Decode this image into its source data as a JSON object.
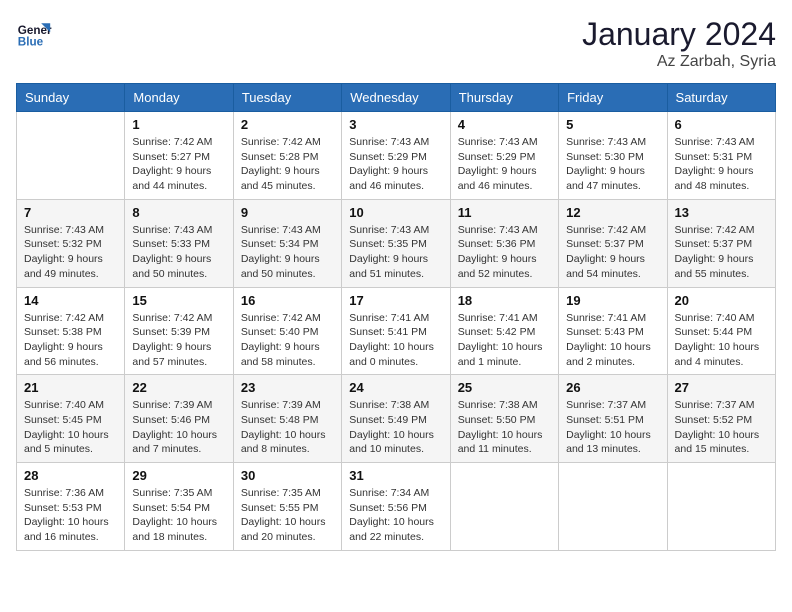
{
  "logo": {
    "line1": "General",
    "line2": "Blue"
  },
  "title": "January 2024",
  "location": "Az Zarbah, Syria",
  "days_header": [
    "Sunday",
    "Monday",
    "Tuesday",
    "Wednesday",
    "Thursday",
    "Friday",
    "Saturday"
  ],
  "weeks": [
    [
      {
        "day": "",
        "info": ""
      },
      {
        "day": "1",
        "info": "Sunrise: 7:42 AM\nSunset: 5:27 PM\nDaylight: 9 hours\nand 44 minutes."
      },
      {
        "day": "2",
        "info": "Sunrise: 7:42 AM\nSunset: 5:28 PM\nDaylight: 9 hours\nand 45 minutes."
      },
      {
        "day": "3",
        "info": "Sunrise: 7:43 AM\nSunset: 5:29 PM\nDaylight: 9 hours\nand 46 minutes."
      },
      {
        "day": "4",
        "info": "Sunrise: 7:43 AM\nSunset: 5:29 PM\nDaylight: 9 hours\nand 46 minutes."
      },
      {
        "day": "5",
        "info": "Sunrise: 7:43 AM\nSunset: 5:30 PM\nDaylight: 9 hours\nand 47 minutes."
      },
      {
        "day": "6",
        "info": "Sunrise: 7:43 AM\nSunset: 5:31 PM\nDaylight: 9 hours\nand 48 minutes."
      }
    ],
    [
      {
        "day": "7",
        "info": "Sunrise: 7:43 AM\nSunset: 5:32 PM\nDaylight: 9 hours\nand 49 minutes."
      },
      {
        "day": "8",
        "info": "Sunrise: 7:43 AM\nSunset: 5:33 PM\nDaylight: 9 hours\nand 50 minutes."
      },
      {
        "day": "9",
        "info": "Sunrise: 7:43 AM\nSunset: 5:34 PM\nDaylight: 9 hours\nand 50 minutes."
      },
      {
        "day": "10",
        "info": "Sunrise: 7:43 AM\nSunset: 5:35 PM\nDaylight: 9 hours\nand 51 minutes."
      },
      {
        "day": "11",
        "info": "Sunrise: 7:43 AM\nSunset: 5:36 PM\nDaylight: 9 hours\nand 52 minutes."
      },
      {
        "day": "12",
        "info": "Sunrise: 7:42 AM\nSunset: 5:37 PM\nDaylight: 9 hours\nand 54 minutes."
      },
      {
        "day": "13",
        "info": "Sunrise: 7:42 AM\nSunset: 5:37 PM\nDaylight: 9 hours\nand 55 minutes."
      }
    ],
    [
      {
        "day": "14",
        "info": "Sunrise: 7:42 AM\nSunset: 5:38 PM\nDaylight: 9 hours\nand 56 minutes."
      },
      {
        "day": "15",
        "info": "Sunrise: 7:42 AM\nSunset: 5:39 PM\nDaylight: 9 hours\nand 57 minutes."
      },
      {
        "day": "16",
        "info": "Sunrise: 7:42 AM\nSunset: 5:40 PM\nDaylight: 9 hours\nand 58 minutes."
      },
      {
        "day": "17",
        "info": "Sunrise: 7:41 AM\nSunset: 5:41 PM\nDaylight: 10 hours\nand 0 minutes."
      },
      {
        "day": "18",
        "info": "Sunrise: 7:41 AM\nSunset: 5:42 PM\nDaylight: 10 hours\nand 1 minute."
      },
      {
        "day": "19",
        "info": "Sunrise: 7:41 AM\nSunset: 5:43 PM\nDaylight: 10 hours\nand 2 minutes."
      },
      {
        "day": "20",
        "info": "Sunrise: 7:40 AM\nSunset: 5:44 PM\nDaylight: 10 hours\nand 4 minutes."
      }
    ],
    [
      {
        "day": "21",
        "info": "Sunrise: 7:40 AM\nSunset: 5:45 PM\nDaylight: 10 hours\nand 5 minutes."
      },
      {
        "day": "22",
        "info": "Sunrise: 7:39 AM\nSunset: 5:46 PM\nDaylight: 10 hours\nand 7 minutes."
      },
      {
        "day": "23",
        "info": "Sunrise: 7:39 AM\nSunset: 5:48 PM\nDaylight: 10 hours\nand 8 minutes."
      },
      {
        "day": "24",
        "info": "Sunrise: 7:38 AM\nSunset: 5:49 PM\nDaylight: 10 hours\nand 10 minutes."
      },
      {
        "day": "25",
        "info": "Sunrise: 7:38 AM\nSunset: 5:50 PM\nDaylight: 10 hours\nand 11 minutes."
      },
      {
        "day": "26",
        "info": "Sunrise: 7:37 AM\nSunset: 5:51 PM\nDaylight: 10 hours\nand 13 minutes."
      },
      {
        "day": "27",
        "info": "Sunrise: 7:37 AM\nSunset: 5:52 PM\nDaylight: 10 hours\nand 15 minutes."
      }
    ],
    [
      {
        "day": "28",
        "info": "Sunrise: 7:36 AM\nSunset: 5:53 PM\nDaylight: 10 hours\nand 16 minutes."
      },
      {
        "day": "29",
        "info": "Sunrise: 7:35 AM\nSunset: 5:54 PM\nDaylight: 10 hours\nand 18 minutes."
      },
      {
        "day": "30",
        "info": "Sunrise: 7:35 AM\nSunset: 5:55 PM\nDaylight: 10 hours\nand 20 minutes."
      },
      {
        "day": "31",
        "info": "Sunrise: 7:34 AM\nSunset: 5:56 PM\nDaylight: 10 hours\nand 22 minutes."
      },
      {
        "day": "",
        "info": ""
      },
      {
        "day": "",
        "info": ""
      },
      {
        "day": "",
        "info": ""
      }
    ]
  ]
}
